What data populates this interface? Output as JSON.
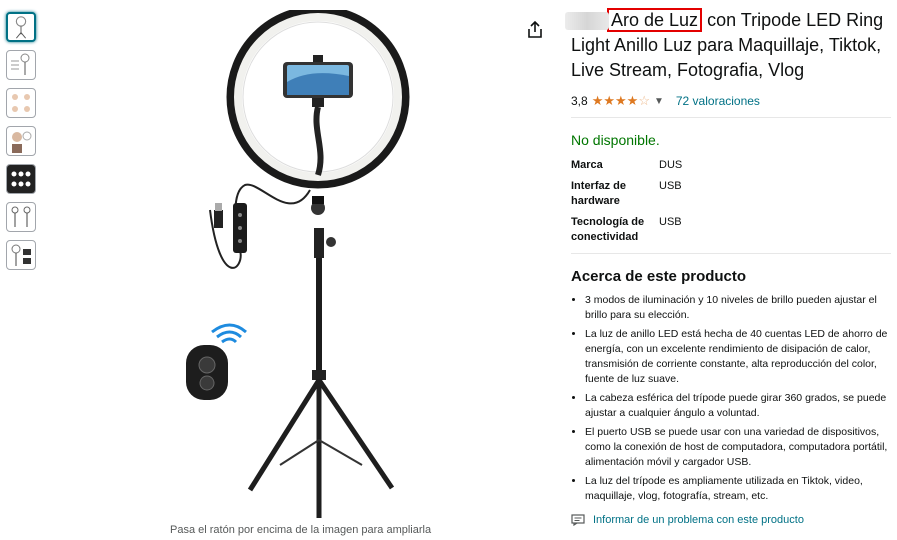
{
  "product": {
    "title_highlight": "Aro de Luz",
    "title_first_line_rest": " con Tripode LED Ring",
    "title_rest": "Light Anillo Luz para Maquillaje, Tiktok, Live Stream, Fotografia, Vlog",
    "rating_value": "3,8",
    "stars": "★★★★",
    "star_empty": "☆",
    "ratings_count": "72 valoraciones",
    "availability": "No disponible.",
    "specs": [
      {
        "key": "Marca",
        "value": "DUS"
      },
      {
        "key": "Interfaz de hardware",
        "value": "USB"
      },
      {
        "key": "Tecnología de conectividad",
        "value": "USB"
      }
    ]
  },
  "about": {
    "heading": "Acerca de este producto",
    "bullets": [
      "3 modos de iluminación y 10 niveles de brillo pueden ajustar el brillo para su elección.",
      "La luz de anillo LED está hecha de 40 cuentas LED de ahorro de energía, con un excelente rendimiento de disipación de calor, transmisión de corriente constante, alta reproducción del color, fuente de luz suave.",
      "La cabeza esférica del trípode puede girar 360 grados, se puede ajustar a cualquier ángulo a voluntad.",
      "El puerto USB se puede usar con una variedad de dispositivos, como la conexión de host de computadora, computadora portátil, alimentación móvil y cargador USB.",
      "La luz del trípode es ampliamente utilizada en Tiktok, video, maquillaje, vlog, fotografía, stream, etc."
    ]
  },
  "report_label": "Informar de un problema con este producto",
  "hover_hint": "Pasa el ratón por encima de la imagen para ampliarla",
  "colors": {
    "link": "#007185",
    "available": "#007600",
    "star": "#de7921",
    "highlight_box": "#e30000"
  }
}
